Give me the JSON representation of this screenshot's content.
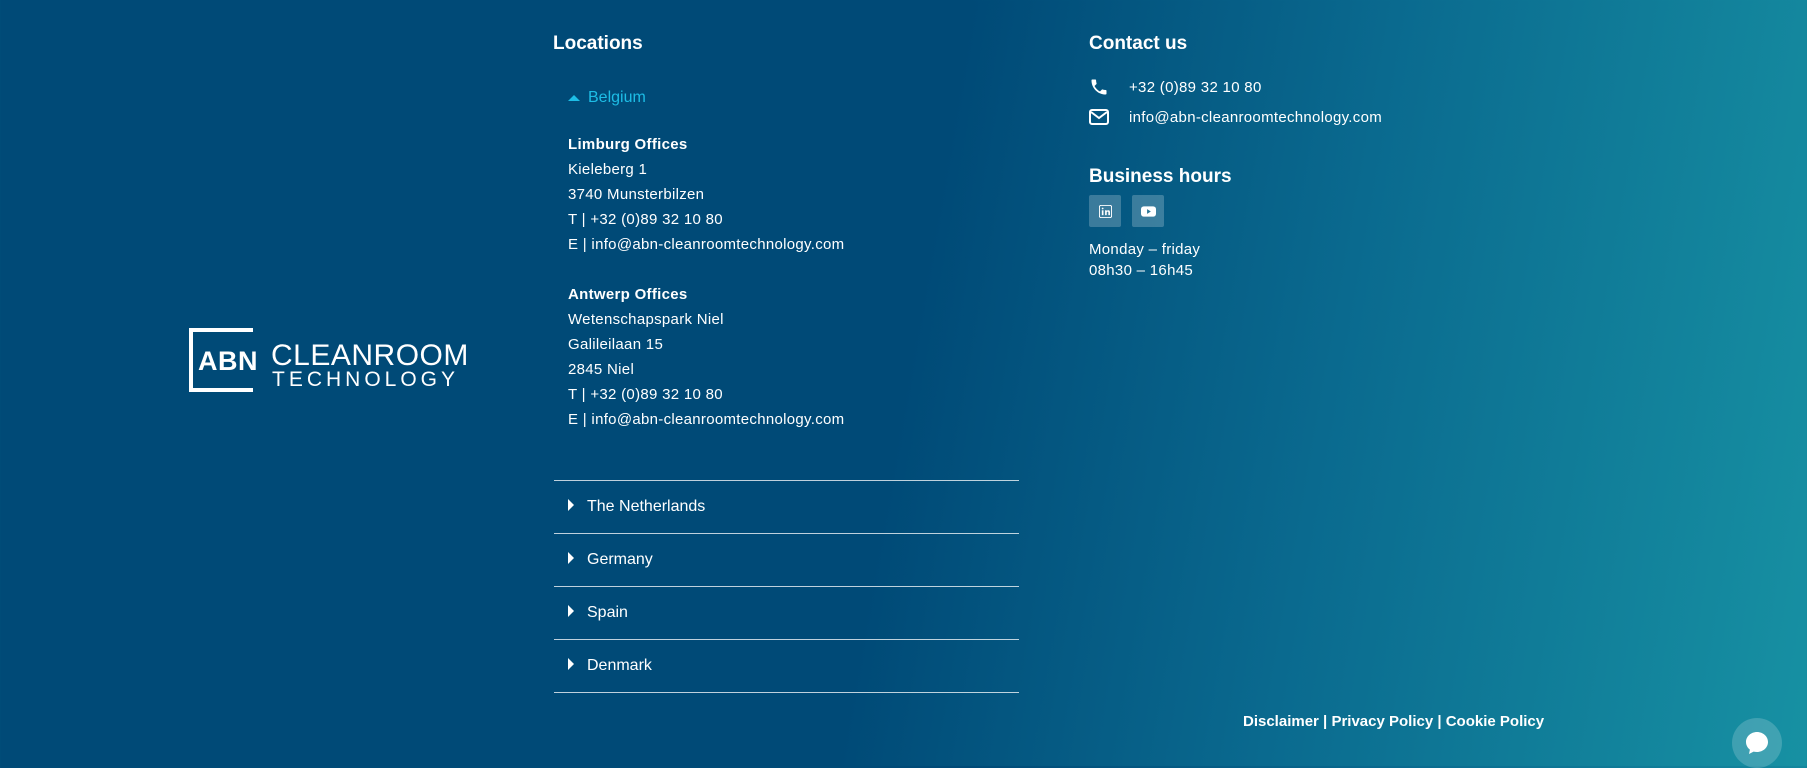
{
  "logo": {
    "abn": "ABN",
    "line1": "CLEANROOM",
    "line2": "TECHNOLOGY"
  },
  "locations": {
    "title": "Locations",
    "expanded": {
      "country": "Belgium",
      "offices": [
        {
          "title": "Limburg Offices",
          "lines": [
            "Kieleberg 1",
            "3740 Munsterbilzen",
            "T | +32 (0)89 32 10 80",
            "E | info@abn-cleanroomtechnology.com"
          ]
        },
        {
          "title": "Antwerp Offices",
          "lines": [
            "Wetenschapspark Niel",
            "Galileilaan 15",
            "2845 Niel",
            "T | +32 (0)89 32 10 80",
            "E | info@abn-cleanroomtechnology.com"
          ]
        }
      ]
    },
    "collapsed": [
      {
        "label": "The Netherlands"
      },
      {
        "label": "Germany"
      },
      {
        "label": "Spain"
      },
      {
        "label": "Denmark"
      }
    ]
  },
  "contact": {
    "title": "Contact us",
    "phone": "+32 (0)89 32 10 80",
    "email": "info@abn-cleanroomtechnology.com"
  },
  "business_hours": {
    "title": "Business hours",
    "days": "Monday – friday",
    "time": "08h30 – 16h45"
  },
  "socials": [
    {
      "icon": "linkedin-icon"
    },
    {
      "icon": "youtube-icon"
    }
  ],
  "legal": {
    "disclaimer": "Disclaimer",
    "privacy": "Privacy Policy",
    "cookie": "Cookie Policy",
    "separator": " | "
  },
  "colors": {
    "accent": "#1dbde6",
    "bg_dark": "#004a77",
    "bg_light": "#1791a3"
  }
}
